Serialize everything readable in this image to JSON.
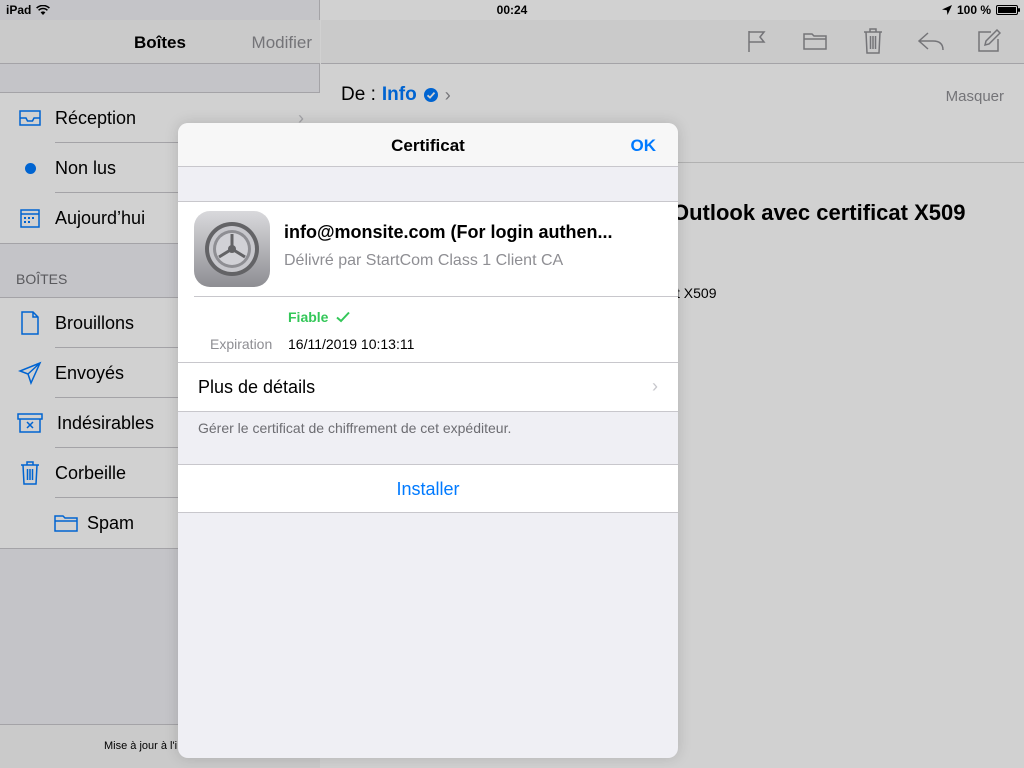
{
  "status_bar": {
    "device": "iPad",
    "time": "00:24",
    "battery": "100 %",
    "battery_level": 1.0
  },
  "sidebar": {
    "title": "Boîtes",
    "edit_label": "Modifier",
    "favorites": [
      {
        "label": "Réception",
        "icon": "inbox-icon"
      },
      {
        "label": "Non lus",
        "icon": "unread-dot-icon"
      },
      {
        "label": "Aujourd’hui",
        "icon": "calendar-icon"
      }
    ],
    "section_header": "BOÎTES",
    "mailboxes": [
      {
        "label": "Brouillons",
        "icon": "draft-icon"
      },
      {
        "label": "Envoyés",
        "icon": "sent-icon"
      },
      {
        "label": "Indésirables",
        "icon": "junk-icon"
      },
      {
        "label": "Corbeille",
        "icon": "trash-icon"
      },
      {
        "label": "Spam",
        "icon": "folder-icon"
      }
    ],
    "footer": "Mise à jour à l'i"
  },
  "message": {
    "from_label": "De :",
    "sender": "Info",
    "hide_label": "Masquer",
    "subject_fragment": "Outlook avec certificat X509",
    "body_fragment": "t X509"
  },
  "certificate_popover": {
    "title": "Certificat",
    "ok_label": "OK",
    "cert_name": "info@monsite.com (For login authen...",
    "issuer": "Délivré par StartCom Class 1 Client CA",
    "trusted": "Fiable",
    "expiration_label": "Expiration",
    "expiration_value": "16/11/2019 10:13:11",
    "more_details": "Plus de détails",
    "footnote": "Gérer le certificat de chiffrement de cet expéditeur.",
    "install_label": "Installer"
  },
  "colors": {
    "accent": "#007aff",
    "trusted": "#34c759"
  }
}
